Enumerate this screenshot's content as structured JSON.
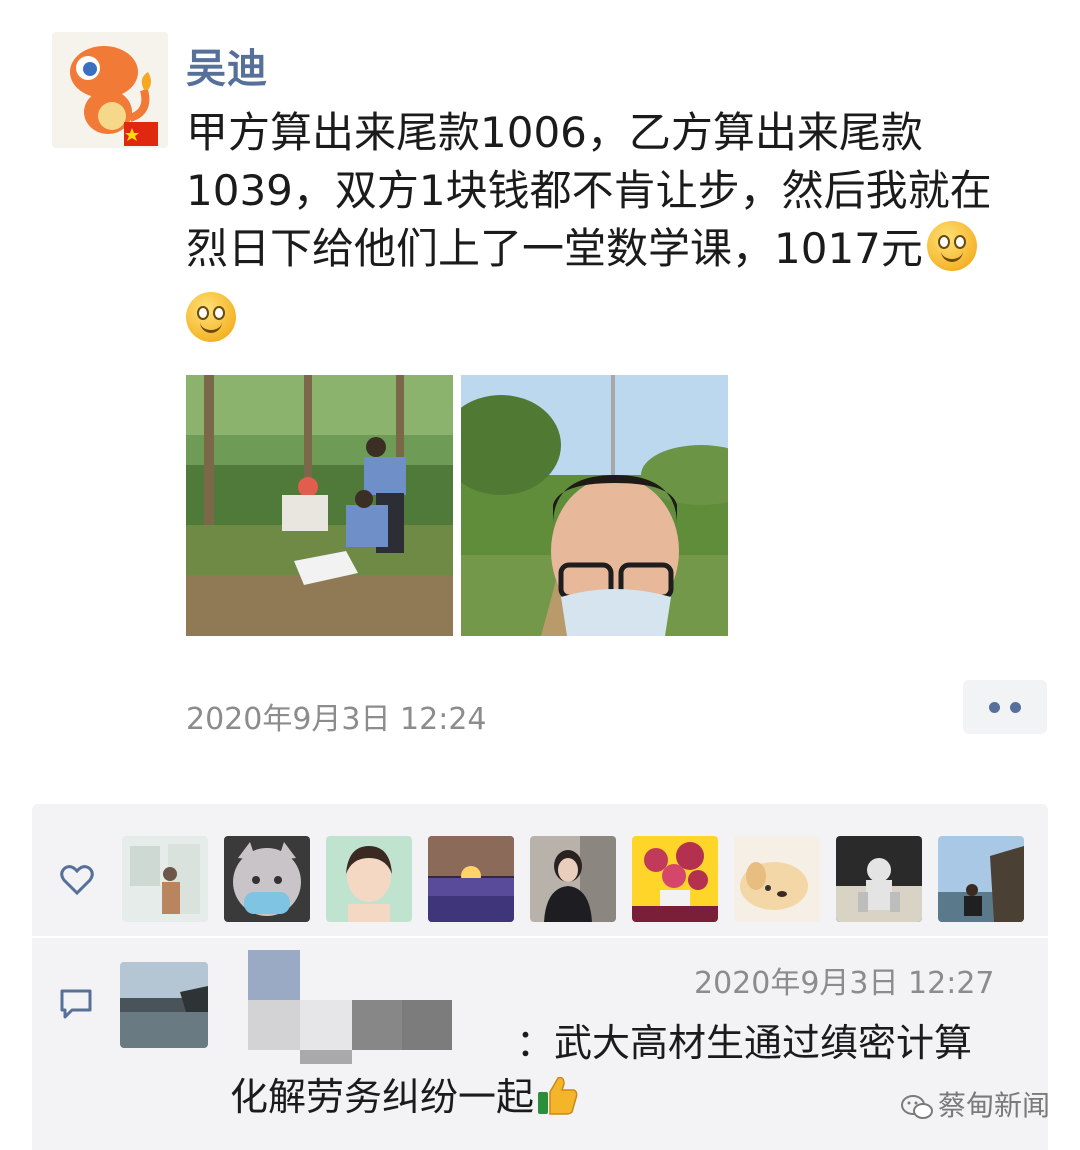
{
  "post": {
    "author": "吴迪",
    "text_lines": [
      "甲方算出来尾款1006，乙方算出来尾款",
      "1039，双方1块钱都不肯让步，然后我就在",
      "烈日下给他们上了一堂数学课，1017元"
    ],
    "emoji_icon": "smile-emoji",
    "timestamp": "2020年9月3日 12:24",
    "more_icon": "more-dots-icon"
  },
  "likes": {
    "icon": "heart-icon",
    "avatars": [
      "liker-avatar-1",
      "liker-avatar-2",
      "liker-avatar-3",
      "liker-avatar-4",
      "liker-avatar-5",
      "liker-avatar-6",
      "liker-avatar-7",
      "liker-avatar-8",
      "liker-avatar-9"
    ]
  },
  "comment": {
    "icon": "comment-icon",
    "timestamp": "2020年9月3日 12:27",
    "text_line1": "：武大高材生通过缜密计算",
    "text_line2": "化解劳务纠纷一起",
    "thumb_icon": "thumbs-up-emoji"
  },
  "watermark": {
    "text": "蔡甸新闻",
    "icon": "wechat-icon"
  },
  "colors": {
    "name_blue": "#56709a",
    "panel_bg": "#f3f3f5",
    "time_gray": "#8c8c8c"
  }
}
